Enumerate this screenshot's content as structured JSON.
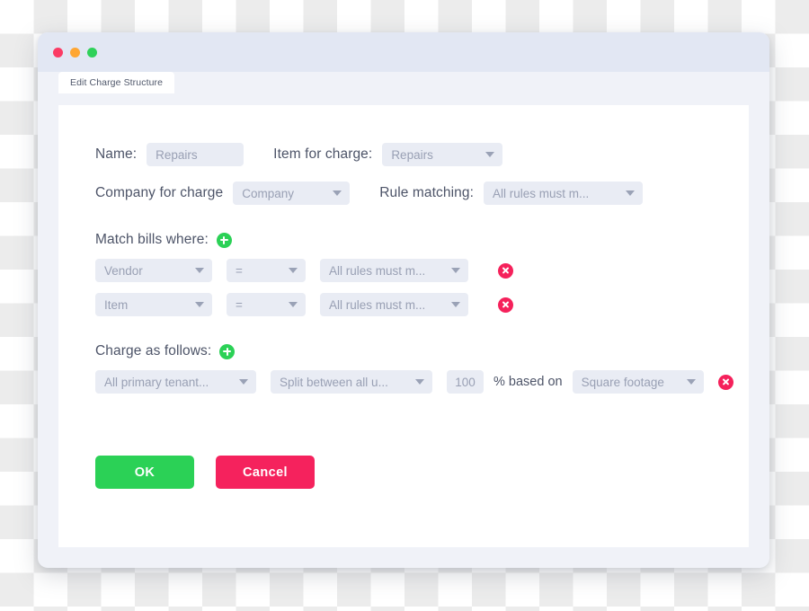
{
  "window": {
    "traffic_lights": [
      "close",
      "minimize",
      "maximize"
    ],
    "colors": {
      "titlebar": "#e2e7f3",
      "panel": "#ffffff",
      "field": "#e9ecf4",
      "accent_green": "#2bd156",
      "accent_red": "#f5215b",
      "label_text": "#4d5468",
      "field_text": "#99a0b4"
    }
  },
  "tab": {
    "label": "Edit Charge Structure"
  },
  "form": {
    "name_label": "Name:",
    "name_value": "Repairs",
    "item_label": "Item for charge:",
    "item_value": "Repairs",
    "company_label": "Company for charge",
    "company_value": "Company",
    "rule_matching_label": "Rule matching:",
    "rule_matching_value": "All rules must m..."
  },
  "match_section": {
    "heading": "Match bills where:",
    "add_label": "+",
    "rows": [
      {
        "field": "Vendor",
        "operator": "=",
        "value": "All rules must m...",
        "delete_label": "x"
      },
      {
        "field": "Item",
        "operator": "=",
        "value": "All rules must m...",
        "delete_label": "x"
      }
    ]
  },
  "charge_section": {
    "heading": "Charge as follows:",
    "add_label": "+",
    "rows": [
      {
        "who": "All primary tenant...",
        "method": "Split between all u...",
        "percent": "100",
        "percent_text": "% based on",
        "basis": "Square footage",
        "delete_label": "x"
      }
    ]
  },
  "actions": {
    "ok_label": "OK",
    "cancel_label": "Cancel"
  }
}
